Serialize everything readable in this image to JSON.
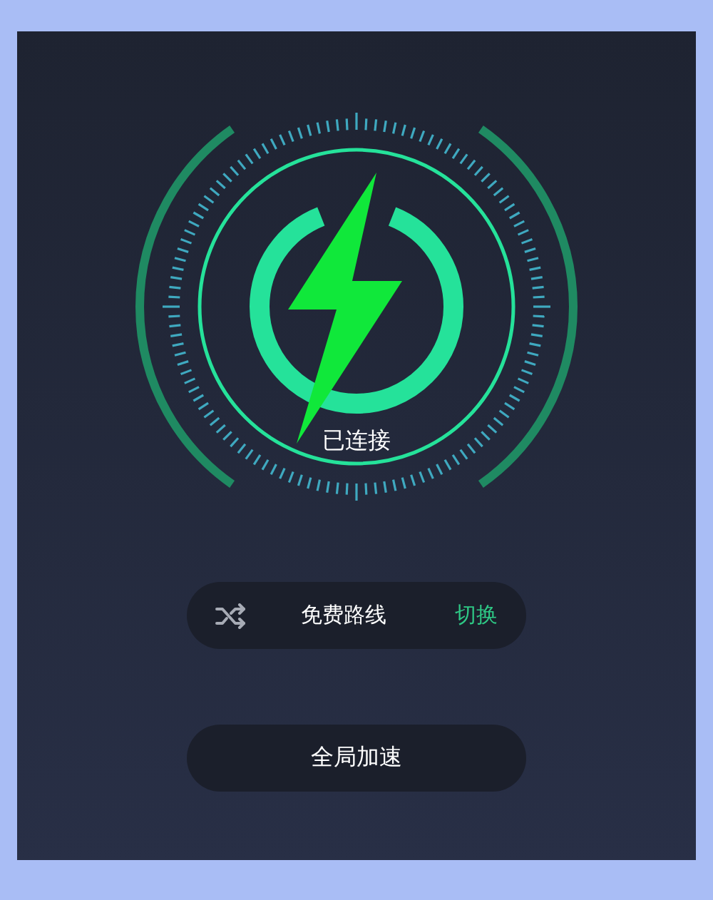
{
  "status": {
    "label": "已连接",
    "connected": true
  },
  "route": {
    "label": "免费路线",
    "action": "切换"
  },
  "buttons": [
    "全局加速"
  ]
}
